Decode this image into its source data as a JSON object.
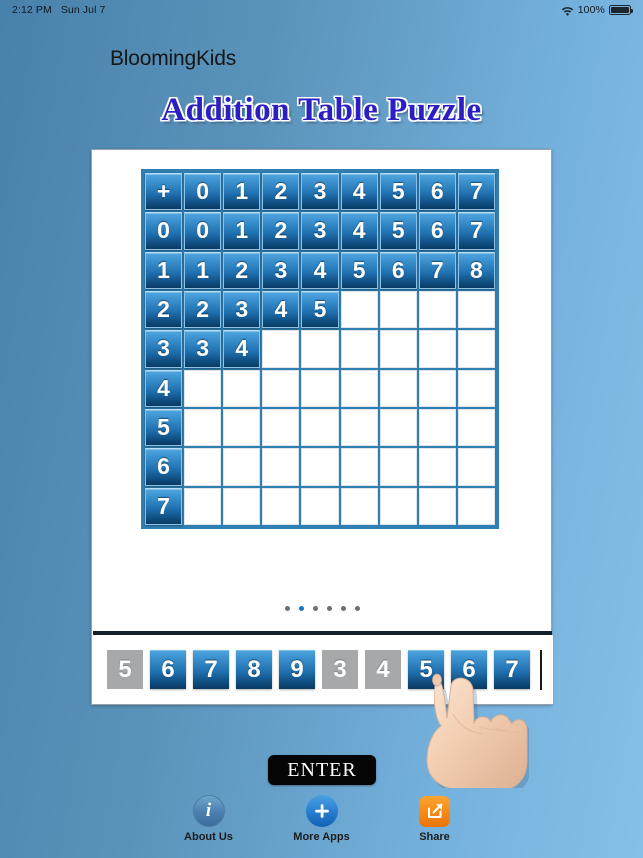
{
  "statusbar": {
    "time": "2:12 PM",
    "date": "Sun Jul 7",
    "wifi_icon": "wifi-icon",
    "battery_percent": "100%",
    "battery_icon": "battery-full-icon"
  },
  "brand": "BloomingKids",
  "title": "Addition Table Puzzle",
  "grid": {
    "rows": [
      [
        {
          "v": "+",
          "f": true
        },
        {
          "v": "0",
          "f": true
        },
        {
          "v": "1",
          "f": true
        },
        {
          "v": "2",
          "f": true
        },
        {
          "v": "3",
          "f": true
        },
        {
          "v": "4",
          "f": true
        },
        {
          "v": "5",
          "f": true
        },
        {
          "v": "6",
          "f": true
        },
        {
          "v": "7",
          "f": true
        }
      ],
      [
        {
          "v": "0",
          "f": true
        },
        {
          "v": "0",
          "f": true
        },
        {
          "v": "1",
          "f": true
        },
        {
          "v": "2",
          "f": true
        },
        {
          "v": "3",
          "f": true
        },
        {
          "v": "4",
          "f": true
        },
        {
          "v": "5",
          "f": true
        },
        {
          "v": "6",
          "f": true
        },
        {
          "v": "7",
          "f": true
        }
      ],
      [
        {
          "v": "1",
          "f": true
        },
        {
          "v": "1",
          "f": true
        },
        {
          "v": "2",
          "f": true
        },
        {
          "v": "3",
          "f": true
        },
        {
          "v": "4",
          "f": true
        },
        {
          "v": "5",
          "f": true
        },
        {
          "v": "6",
          "f": true
        },
        {
          "v": "7",
          "f": true
        },
        {
          "v": "8",
          "f": true
        }
      ],
      [
        {
          "v": "2",
          "f": true
        },
        {
          "v": "2",
          "f": true
        },
        {
          "v": "3",
          "f": true
        },
        {
          "v": "4",
          "f": true
        },
        {
          "v": "5",
          "f": true
        },
        {
          "v": "",
          "f": false
        },
        {
          "v": "",
          "f": false
        },
        {
          "v": "",
          "f": false
        },
        {
          "v": "",
          "f": false
        }
      ],
      [
        {
          "v": "3",
          "f": true
        },
        {
          "v": "3",
          "f": true
        },
        {
          "v": "4",
          "f": true
        },
        {
          "v": "",
          "f": false
        },
        {
          "v": "",
          "f": false
        },
        {
          "v": "",
          "f": false
        },
        {
          "v": "",
          "f": false
        },
        {
          "v": "",
          "f": false
        },
        {
          "v": "",
          "f": false
        }
      ],
      [
        {
          "v": "4",
          "f": true
        },
        {
          "v": "",
          "f": false
        },
        {
          "v": "",
          "f": false
        },
        {
          "v": "",
          "f": false
        },
        {
          "v": "",
          "f": false
        },
        {
          "v": "",
          "f": false
        },
        {
          "v": "",
          "f": false
        },
        {
          "v": "",
          "f": false
        },
        {
          "v": "",
          "f": false
        }
      ],
      [
        {
          "v": "5",
          "f": true
        },
        {
          "v": "",
          "f": false
        },
        {
          "v": "",
          "f": false
        },
        {
          "v": "",
          "f": false
        },
        {
          "v": "",
          "f": false
        },
        {
          "v": "",
          "f": false
        },
        {
          "v": "",
          "f": false
        },
        {
          "v": "",
          "f": false
        },
        {
          "v": "",
          "f": false
        }
      ],
      [
        {
          "v": "6",
          "f": true
        },
        {
          "v": "",
          "f": false
        },
        {
          "v": "",
          "f": false
        },
        {
          "v": "",
          "f": false
        },
        {
          "v": "",
          "f": false
        },
        {
          "v": "",
          "f": false
        },
        {
          "v": "",
          "f": false
        },
        {
          "v": "",
          "f": false
        },
        {
          "v": "",
          "f": false
        }
      ],
      [
        {
          "v": "7",
          "f": true
        },
        {
          "v": "",
          "f": false
        },
        {
          "v": "",
          "f": false
        },
        {
          "v": "",
          "f": false
        },
        {
          "v": "",
          "f": false
        },
        {
          "v": "",
          "f": false
        },
        {
          "v": "",
          "f": false
        },
        {
          "v": "",
          "f": false
        },
        {
          "v": "",
          "f": false
        }
      ]
    ]
  },
  "pager": {
    "count": 6,
    "active_index": 1
  },
  "tray": {
    "chips": [
      {
        "v": "5",
        "state": "gray"
      },
      {
        "v": "6",
        "state": "blue"
      },
      {
        "v": "7",
        "state": "blue"
      },
      {
        "v": "8",
        "state": "blue"
      },
      {
        "v": "9",
        "state": "blue"
      },
      {
        "v": "3",
        "state": "gray"
      },
      {
        "v": "4",
        "state": "gray"
      },
      {
        "v": "5",
        "state": "blue"
      },
      {
        "v": "6",
        "state": "blue"
      },
      {
        "v": "7",
        "state": "blue"
      }
    ]
  },
  "enter_label": "ENTER",
  "toolbar": {
    "items": [
      {
        "label": "About Us",
        "icon": "info-icon"
      },
      {
        "label": "More Apps",
        "icon": "plus-icon"
      },
      {
        "label": "Share",
        "icon": "share-icon"
      }
    ]
  },
  "colors": {
    "accent_blue": "#1f6fae",
    "title_blue": "#2b1fc4",
    "grid_border": "#2f7fb3",
    "chip_gray": "#a6a8aa",
    "share_orange": "#f78a14",
    "bg_left": "#4882ac",
    "bg_right": "#86c0e8"
  }
}
